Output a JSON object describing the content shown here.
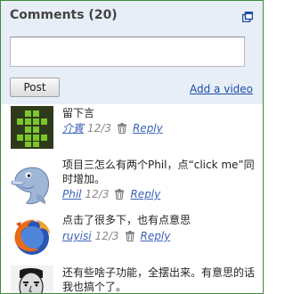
{
  "header": {
    "title": "Comments (20)",
    "popout_icon": "popout-window-icon"
  },
  "compose": {
    "post_label": "Post",
    "add_video_label": "Add a video"
  },
  "comments": [
    {
      "avatar": "green-pixel-avatar",
      "text": "留下言",
      "author": "介賓",
      "date": "12/3",
      "reply_label": "Reply"
    },
    {
      "avatar": "dolphin-avatar",
      "text": "项目三怎么有两个Phil，点“click me”同时增加。",
      "author": "Phil",
      "date": "12/3",
      "reply_label": "Reply"
    },
    {
      "avatar": "firefox-avatar",
      "text": "点击了很多下，也有点意思",
      "author": "ruyisi",
      "date": "12/3",
      "reply_label": "Reply"
    },
    {
      "avatar": "face-avatar",
      "text": "还有些啥子功能，全摆出来。有意思的话我也搞个了。"
    }
  ],
  "colors": {
    "header_bg": "#e8eef7",
    "border": "#3c8b3c",
    "link": "#3b62b5"
  }
}
